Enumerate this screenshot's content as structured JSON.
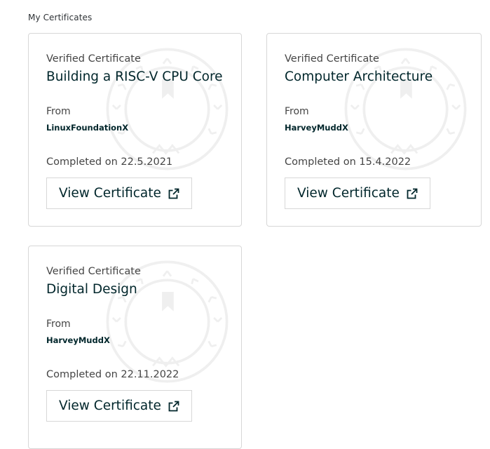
{
  "page": {
    "title": "My Certificates"
  },
  "certificates": [
    {
      "type_label": "Verified Certificate",
      "course": "Building a RISC-V CPU Core",
      "from_label": "From",
      "org": "LinuxFoundationX",
      "completed": "Completed on 22.5.2021",
      "button_label": "View Certificate",
      "seal_icon": "award-seal-icon"
    },
    {
      "type_label": "Verified Certificate",
      "course": "Computer Architecture",
      "from_label": "From",
      "org": "HarveyMuddX",
      "completed": "Completed on 15.4.2022",
      "button_label": "View Certificate",
      "seal_icon": "award-seal-icon"
    },
    {
      "type_label": "Verified Certificate",
      "course": "Digital Design",
      "from_label": "From",
      "org": "HarveyMuddX",
      "completed": "Completed on 22.11.2022",
      "button_label": "View Certificate",
      "seal_icon": "award-seal-icon"
    }
  ],
  "colors": {
    "text_primary": "#00262b",
    "text_secondary": "#454545",
    "border": "#d7d7d7"
  }
}
